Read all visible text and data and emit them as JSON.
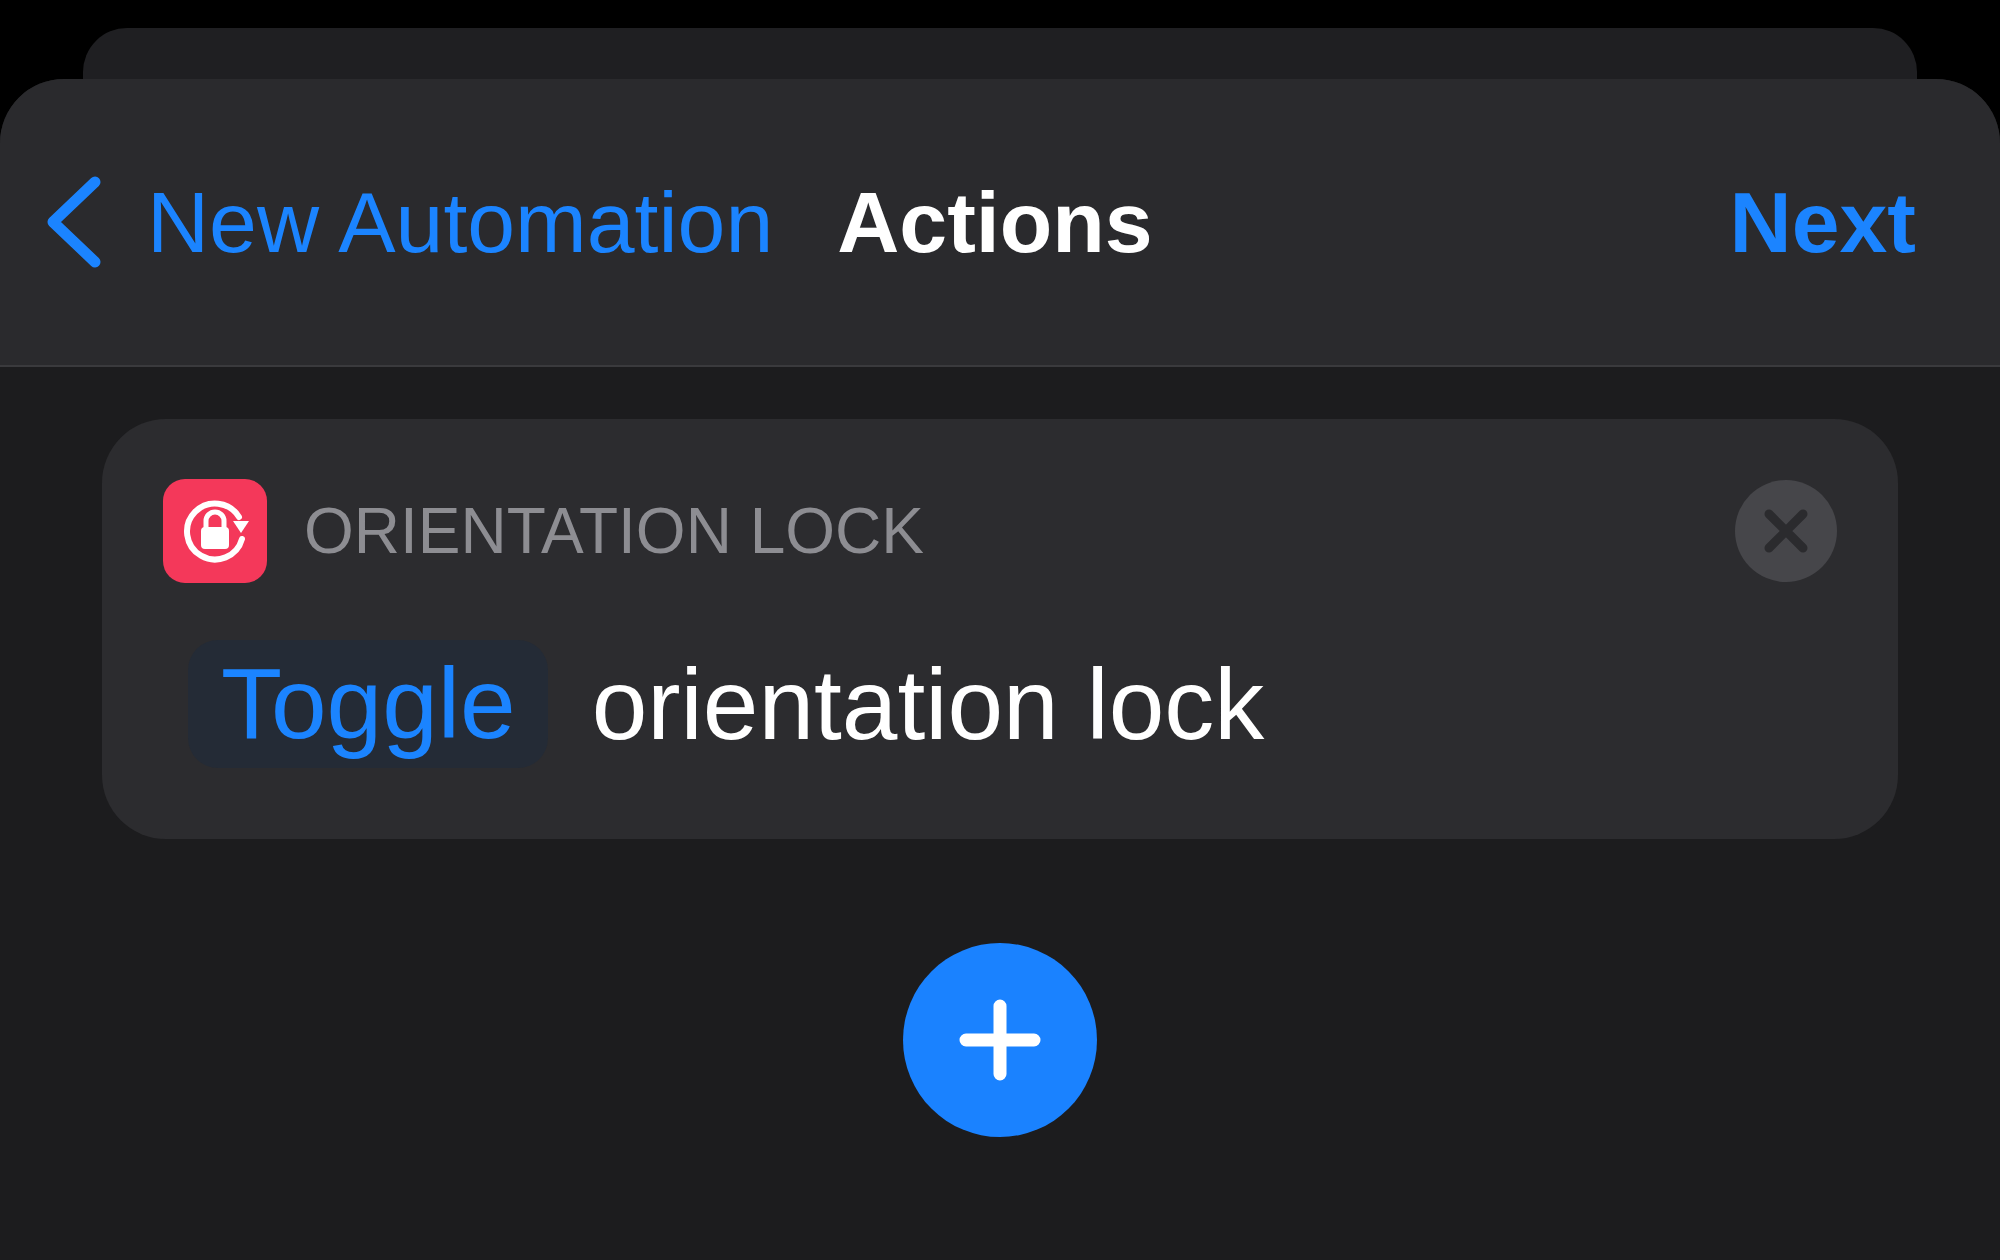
{
  "navigation": {
    "back_label": "New Automation",
    "title": "Actions",
    "next_label": "Next"
  },
  "actions": [
    {
      "app_label": "ORIENTATION LOCK",
      "parameter": "Toggle",
      "text": "orientation lock"
    }
  ]
}
